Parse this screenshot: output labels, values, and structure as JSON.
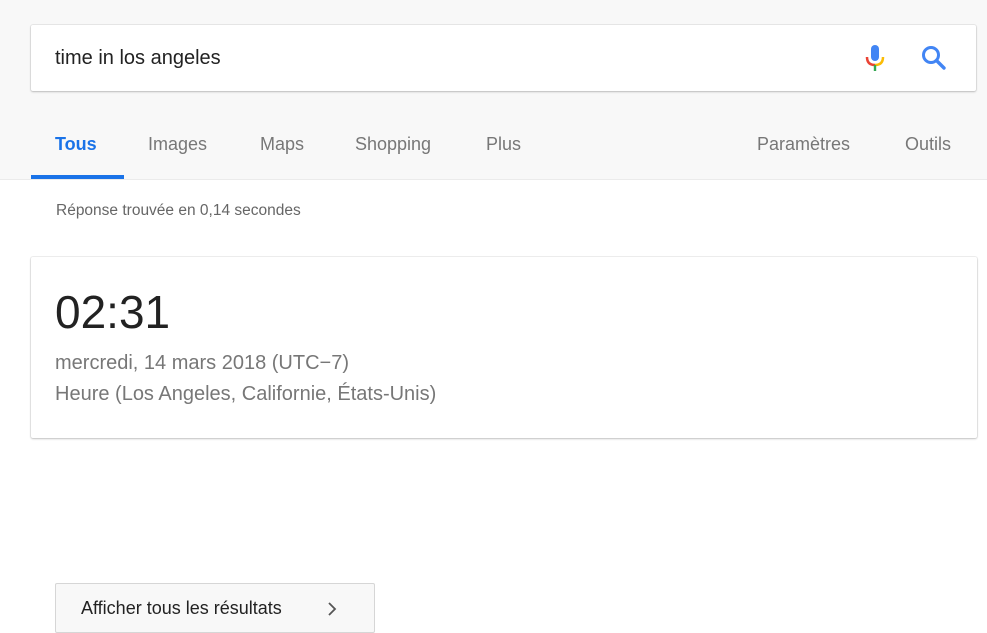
{
  "search": {
    "query": "time in los angeles",
    "mic_icon": "microphone-icon",
    "search_icon": "search-icon",
    "accent": "#1a73e8"
  },
  "tabs": [
    {
      "label": "Tous",
      "active": true
    },
    {
      "label": "Images",
      "active": false
    },
    {
      "label": "Maps",
      "active": false
    },
    {
      "label": "Shopping",
      "active": false
    },
    {
      "label": "Plus",
      "active": false
    }
  ],
  "tools": {
    "settings_label": "Paramètres",
    "tools_label": "Outils"
  },
  "result_stats": "Réponse trouvée en 0,14 secondes",
  "time_card": {
    "time": "02:31",
    "date": "mercredi, 14 mars 2018 (UTC−7)",
    "location": "Heure (Los Angeles, Californie, États-Unis)"
  },
  "more_results": {
    "label": "Afficher tous les résultats",
    "icon": "chevron-right-icon"
  }
}
